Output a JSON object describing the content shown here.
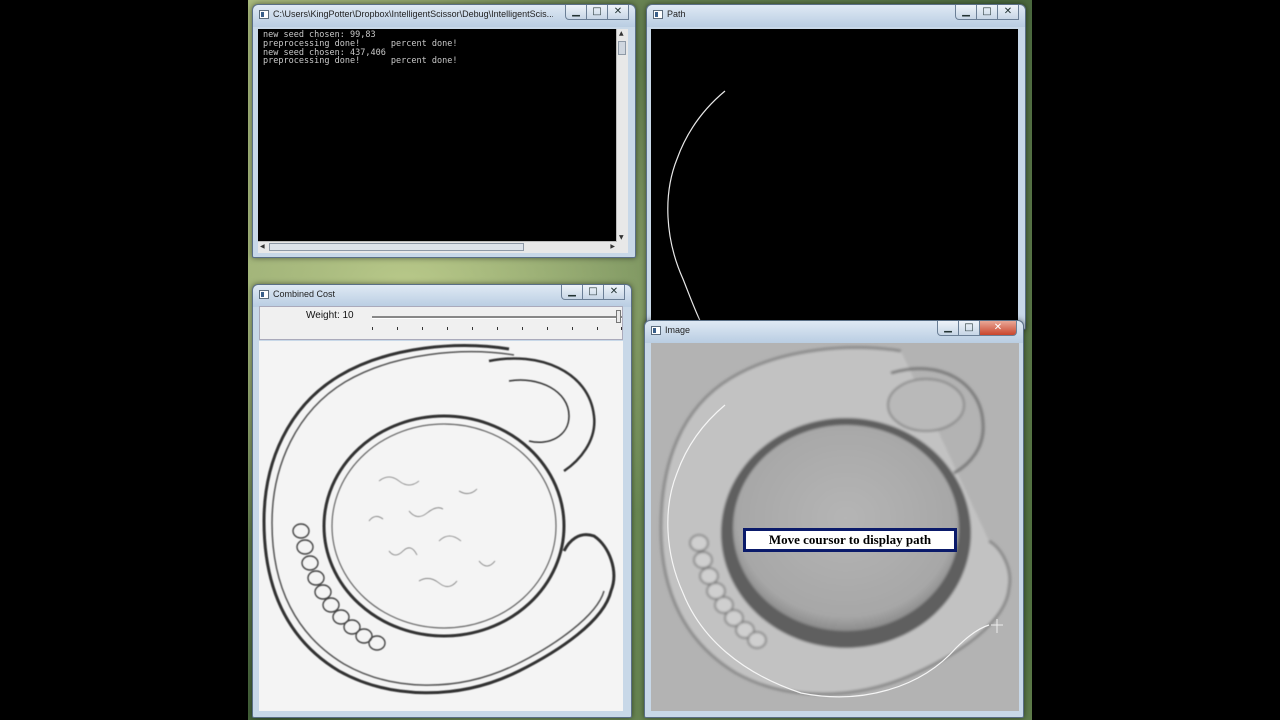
{
  "console_window": {
    "title": "C:\\Users\\KingPotter\\Dropbox\\IntelligentScissor\\Debug\\IntelligentScis...",
    "lines": [
      "new seed chosen: 99,83",
      "preprocessing done!      percent done!",
      "new seed chosen: 437,406",
      "preprocessing done!      percent done!"
    ]
  },
  "path_window": {
    "title": "Path"
  },
  "cost_window": {
    "title": "Combined Cost",
    "trackbar_label": "Weight: 10"
  },
  "image_window": {
    "title": "Image",
    "overlay_message": "Move coursor to display path"
  },
  "controls": {
    "minimize": "▁",
    "maximize": "□",
    "close": "✕"
  },
  "icons": [
    "app-icon",
    "minimize-icon",
    "maximize-icon",
    "close-icon",
    "scroll-arrow-icon",
    "crosshair-cursor-icon"
  ]
}
